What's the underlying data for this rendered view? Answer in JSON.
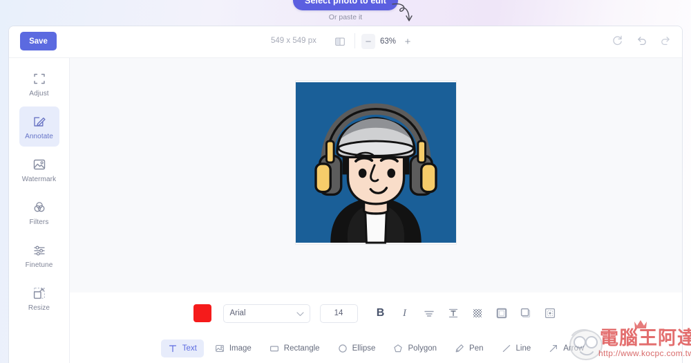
{
  "promo": {
    "button_label": "Select photo to edit",
    "subtitle": "Or paste it",
    "arrow_icon": "curved-arrow-icon",
    "accent": "#5b5fe0"
  },
  "topbar": {
    "save_label": "Save",
    "dimensions": "549 x 549 px",
    "compare_icon": "compare-split-icon",
    "zoom": {
      "minus": "−",
      "value": "63%",
      "plus": "+"
    },
    "history": [
      {
        "name": "reset-icon",
        "label": "Reset"
      },
      {
        "name": "undo-icon",
        "label": "Undo"
      },
      {
        "name": "redo-icon",
        "label": "Redo"
      }
    ]
  },
  "sidebar": {
    "items": [
      {
        "label": "Adjust",
        "icon": "crop-icon",
        "active": false
      },
      {
        "label": "Annotate",
        "icon": "pencil-icon",
        "active": true
      },
      {
        "label": "Watermark",
        "icon": "image-icon",
        "active": false
      },
      {
        "label": "Filters",
        "icon": "venn-icon",
        "active": false
      },
      {
        "label": "Finetune",
        "icon": "sliders-icon",
        "active": false
      },
      {
        "label": "Resize",
        "icon": "resize-icon",
        "active": false
      }
    ]
  },
  "canvas": {
    "image_alt": "avatar-illustration-person-with-cap-and-headphones",
    "background": "#f8f9fb",
    "artwork_bg": "#1a5f98"
  },
  "properties": {
    "color": "#f51b1b",
    "font_family": "Arial",
    "font_size": "14",
    "bold_label": "B",
    "italic_label": "I",
    "buttons": [
      {
        "name": "text-align-icon"
      },
      {
        "name": "line-height-icon"
      },
      {
        "name": "opacity-icon"
      },
      {
        "name": "stroke-icon"
      },
      {
        "name": "shadow-icon"
      },
      {
        "name": "position-icon"
      }
    ]
  },
  "tools": [
    {
      "label": "Text",
      "icon": "text-icon",
      "active": true
    },
    {
      "label": "Image",
      "icon": "image-icon",
      "active": false
    },
    {
      "label": "Rectangle",
      "icon": "rectangle-icon",
      "active": false
    },
    {
      "label": "Ellipse",
      "icon": "ellipse-icon",
      "active": false
    },
    {
      "label": "Polygon",
      "icon": "polygon-icon",
      "active": false
    },
    {
      "label": "Pen",
      "icon": "pen-icon",
      "active": false
    },
    {
      "label": "Line",
      "icon": "line-icon",
      "active": false
    },
    {
      "label": "Arrow",
      "icon": "arrow-icon",
      "active": false
    }
  ],
  "watermark": {
    "text_cn": "電腦王阿達",
    "url": "http://www.kocpc.com.tw",
    "color": "#dd4b4b"
  }
}
